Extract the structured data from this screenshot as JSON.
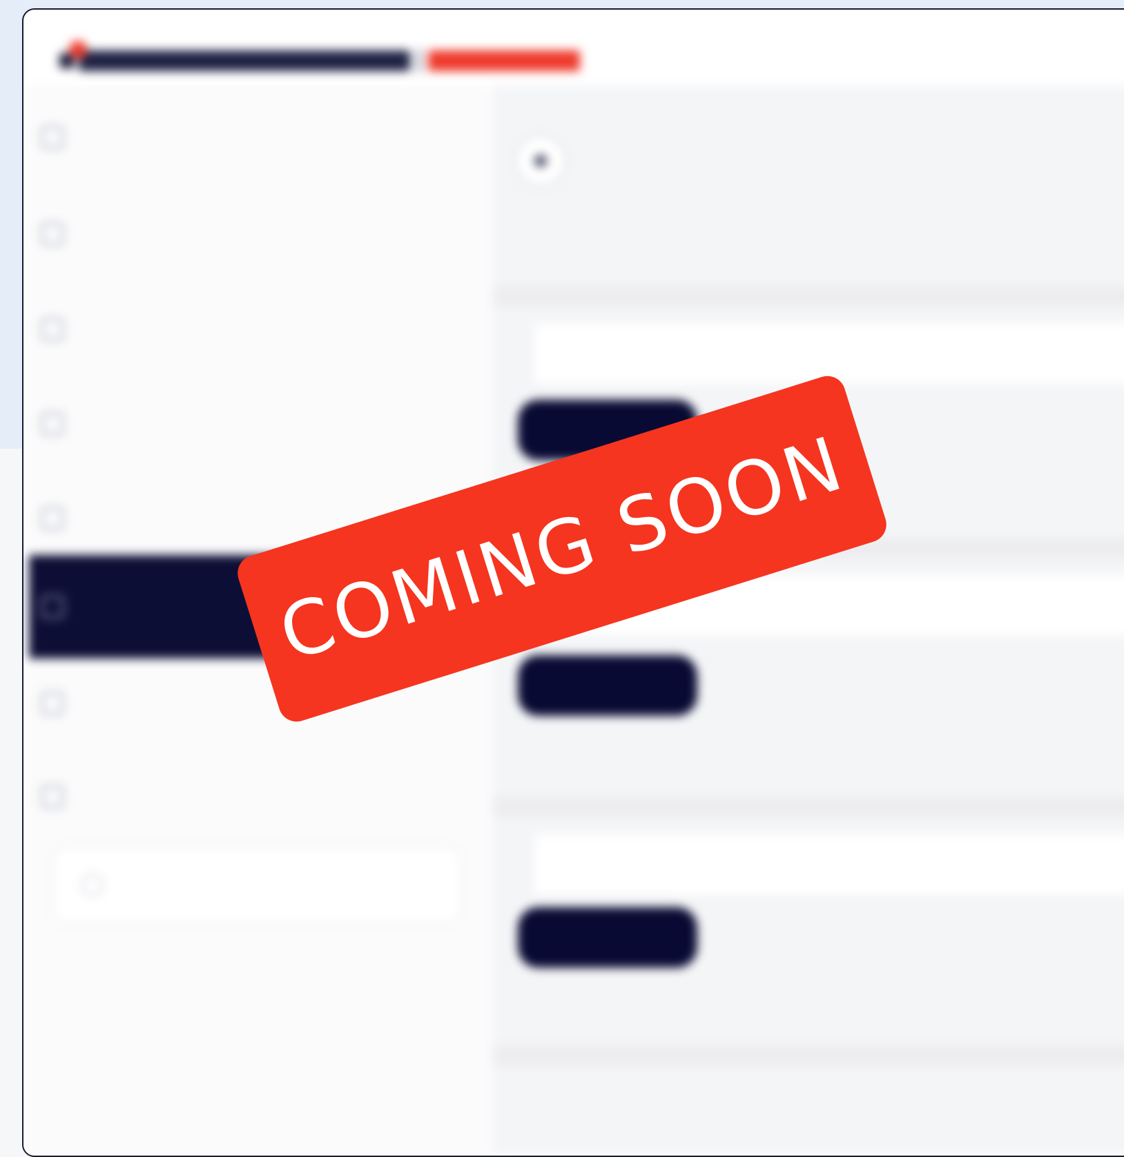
{
  "overlay": {
    "badge_text": "COMING SOON",
    "badge_color": "#f5351f"
  },
  "brand": {
    "primary_color": "#0d0e35",
    "accent_color": "#ee3a2b"
  },
  "sidebar": {
    "items": [
      {
        "icon": "user-icon",
        "label": "",
        "sub": ""
      },
      {
        "icon": "chart-icon",
        "label": "",
        "sub": ""
      },
      {
        "icon": "card-icon",
        "label": "",
        "sub": ""
      },
      {
        "icon": "document-icon",
        "label": "",
        "sub": ""
      },
      {
        "icon": "settings-icon",
        "label": "",
        "sub": ""
      },
      {
        "icon": "lock-icon",
        "label": "",
        "sub": "",
        "active": true
      },
      {
        "icon": "help-icon",
        "label": "",
        "sub": ""
      },
      {
        "icon": "logout-icon",
        "label": "",
        "sub": ""
      }
    ],
    "bottom_box": {
      "icon": "info-icon",
      "label": ""
    }
  },
  "main": {
    "header_title": "",
    "sections": [
      {
        "label": "",
        "button": "",
        "link": ""
      },
      {
        "label": "",
        "button": "",
        "link": ""
      },
      {
        "label": "",
        "button": "",
        "link": ""
      },
      {
        "label": "",
        "button": "",
        "link": ""
      }
    ]
  }
}
